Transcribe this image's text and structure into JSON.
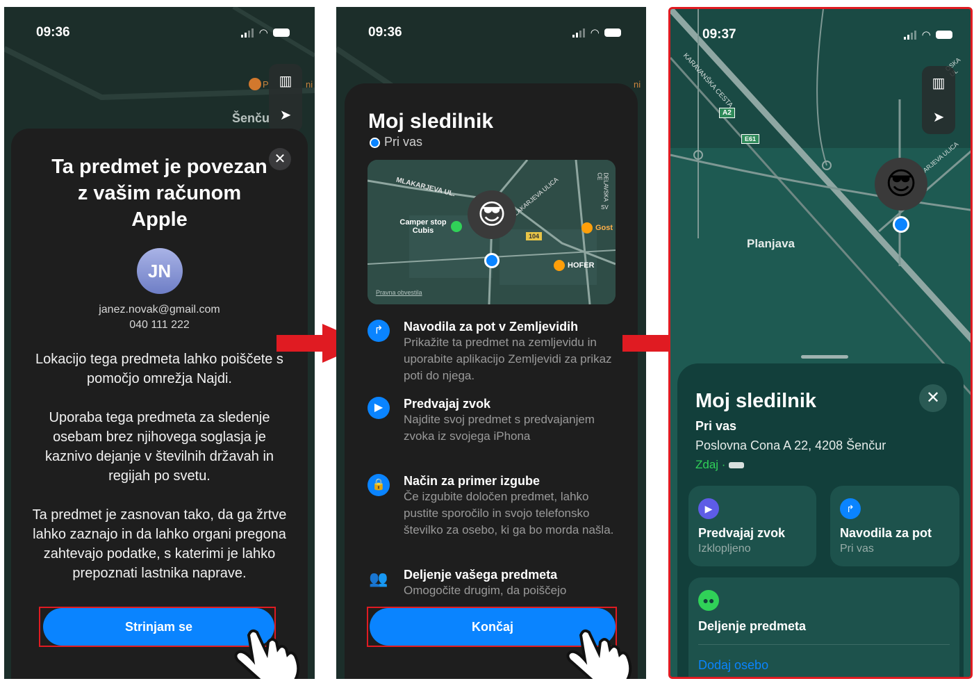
{
  "panel1": {
    "time": "09:36",
    "map_label_town": "Šenču",
    "map_label_poi": "P",
    "map_label_poi2": "ni",
    "title": "Ta predmet je povezan z vašim računom Apple",
    "avatar_initials": "JN",
    "email": "janez.novak@gmail.com",
    "phone": "040 111 222",
    "para1": "Lokacijo tega predmeta lahko poiščete s pomočjo omrežja Najdi.",
    "para2": "Uporaba tega predmeta za sledenje osebam brez njihovega soglasja je kaznivo dejanje v številnih državah in regijah po svetu.",
    "para3": "Ta predmet je zasnovan tako, da ga žrtve lahko zaznajo in da lahko organi pregona zahtevajo podatke, s katerimi je lahko prepoznati lastnika naprave.",
    "button": "Strinjam se"
  },
  "panel2": {
    "time": "09:36",
    "map_label_poi2": "ni",
    "title": "Moj sledilnik",
    "subtitle": "Pri vas",
    "minimap": {
      "street1": "MLAKARJEVA UL.",
      "street2": "MLAKARJEVA ULICA",
      "street3": "DELAVSKA CE",
      "poi1": "Camper stop Cubis",
      "poi2": "Gost",
      "poi3": "HOFER",
      "road": "104",
      "legal": "Pravna obvestila",
      "sv": "SV"
    },
    "features": [
      {
        "icon": "directions-icon",
        "title": "Navodila za pot v Zemljevidih",
        "desc": "Prikažite ta predmet na zemljevidu in uporabite aplikacijo Zemljevidi za prikaz poti do njega."
      },
      {
        "icon": "play-icon",
        "title": "Predvajaj zvok",
        "desc": "Najdite svoj predmet s predvajanjem zvoka iz svojega iPhona"
      },
      {
        "icon": "lock-icon",
        "title": "Način za primer izgube",
        "desc": "Če izgubite določen predmet, lahko pustite sporočilo in svojo telefonsko številko za osebo, ki ga bo morda našla."
      },
      {
        "icon": "people-icon",
        "title": "Deljenje vašega predmeta",
        "desc": "Omogočite drugim, da poiščejo"
      }
    ],
    "button": "Končaj"
  },
  "panel3": {
    "time": "09:37",
    "road_label1": "A2",
    "road_label2": "E61",
    "street_label": "KARAVANŠKA CESTA",
    "street_label2": "MLAKARJEVA ULICA",
    "street_label3": "OSKA UL",
    "place": "Planjava",
    "title": "Moj sledilnik",
    "status": "Pri vas",
    "address": "Poslovna Cona A 22, 4208 Šenčur",
    "now": "Zdaj",
    "tile1_title": "Predvajaj zvok",
    "tile1_sub": "Izklopljeno",
    "tile2_title": "Navodila za pot",
    "tile2_sub": "Pri vas",
    "share_title": "Deljenje predmeta",
    "add_person": "Dodaj osebo"
  },
  "colors": {
    "accent": "#0a84ff",
    "highlight": "#e01b22",
    "green": "#30d158"
  }
}
